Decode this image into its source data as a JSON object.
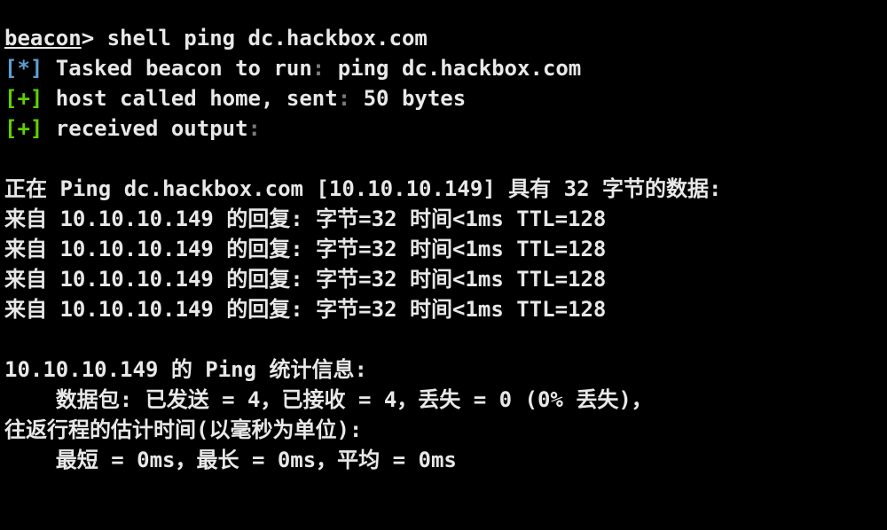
{
  "terminal": {
    "prompt": {
      "user": "beacon",
      "symbol": "> ",
      "command": "shell ping dc.hackbox.com"
    },
    "tasked": {
      "marker": "[*]",
      "label": " Tasked beacon to run",
      "sep": ":",
      "value": " ping dc.hackbox.com"
    },
    "called_home": {
      "marker": "[+]",
      "label": " host called home, sent",
      "sep": ":",
      "value": " 50 bytes"
    },
    "received": {
      "marker": "[+]",
      "label": " received output",
      "sep": ":"
    },
    "output": {
      "pinging": "正在 Ping dc.hackbox.com [10.10.10.149] 具有 32 字节的数据:",
      "replies": [
        "来自 10.10.10.149 的回复: 字节=32 时间<1ms TTL=128",
        "来自 10.10.10.149 的回复: 字节=32 时间<1ms TTL=128",
        "来自 10.10.10.149 的回复: 字节=32 时间<1ms TTL=128",
        "来自 10.10.10.149 的回复: 字节=32 时间<1ms TTL=128"
      ],
      "stats_header": "10.10.10.149 的 Ping 统计信息:",
      "packets": "    数据包: 已发送 = 4，已接收 = 4，丢失 = 0 (0% 丢失)，",
      "rtt_header": "往返行程的估计时间(以毫秒为单位):",
      "rtt_values": "    最短 = 0ms，最长 = 0ms，平均 = 0ms"
    }
  },
  "colors": {
    "background": "#000000",
    "text": "#e8e8e8",
    "info_marker": "#5a9fd4",
    "success_marker": "#5fd000",
    "separator": "#7a7a7a"
  }
}
